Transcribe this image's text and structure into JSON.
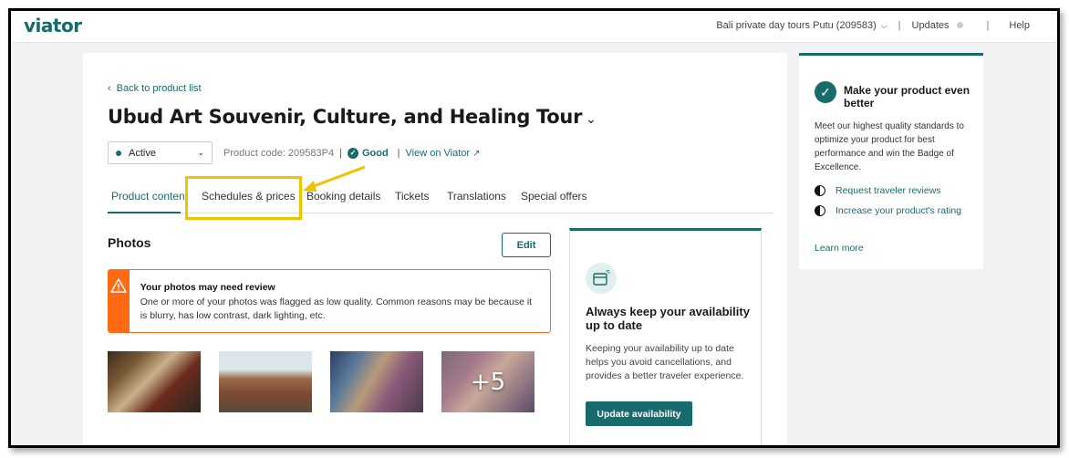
{
  "topbar": {
    "logo": "viator",
    "account": "Bali private day tours Putu (209583)",
    "updates": "Updates",
    "help": "Help"
  },
  "product": {
    "back": "Back to product list",
    "title": "Ubud Art Souvenir, Culture, and Healing Tour",
    "status": "Active",
    "code_label": "Product code: 209583P4",
    "quality": "Good",
    "view_link": "View on Viator"
  },
  "tabs": [
    {
      "label": "Product content",
      "active": true
    },
    {
      "label": "Schedules & prices",
      "active": false
    },
    {
      "label": "Booking details",
      "active": false
    },
    {
      "label": "Tickets",
      "active": false
    },
    {
      "label": "Translations",
      "active": false
    },
    {
      "label": "Special offers",
      "active": false
    }
  ],
  "photos": {
    "title": "Photos",
    "edit": "Edit",
    "alert_title": "Your photos may need review",
    "alert_text": "One or more of your photos was flagged as low quality. Common reasons may be because it is blurry, has low contrast, dark lighting, etc.",
    "more_count": "+5"
  },
  "availability": {
    "title": "Always keep your availability up to date",
    "desc": "Keeping your availability up to date helps you avoid cancellations, and provides a better traveler experience.",
    "button": "Update availability"
  },
  "side": {
    "title": "Make your product even better",
    "desc": "Meet our highest quality standards to optimize your product for best performance and win the Badge of Excellence.",
    "link1": "Request traveler reviews",
    "link2": "Increase your product's rating",
    "learn_more": "Learn more"
  },
  "colors": {
    "brand": "#186b6d",
    "alert": "#ff6a13",
    "highlight": "#f2c100"
  }
}
